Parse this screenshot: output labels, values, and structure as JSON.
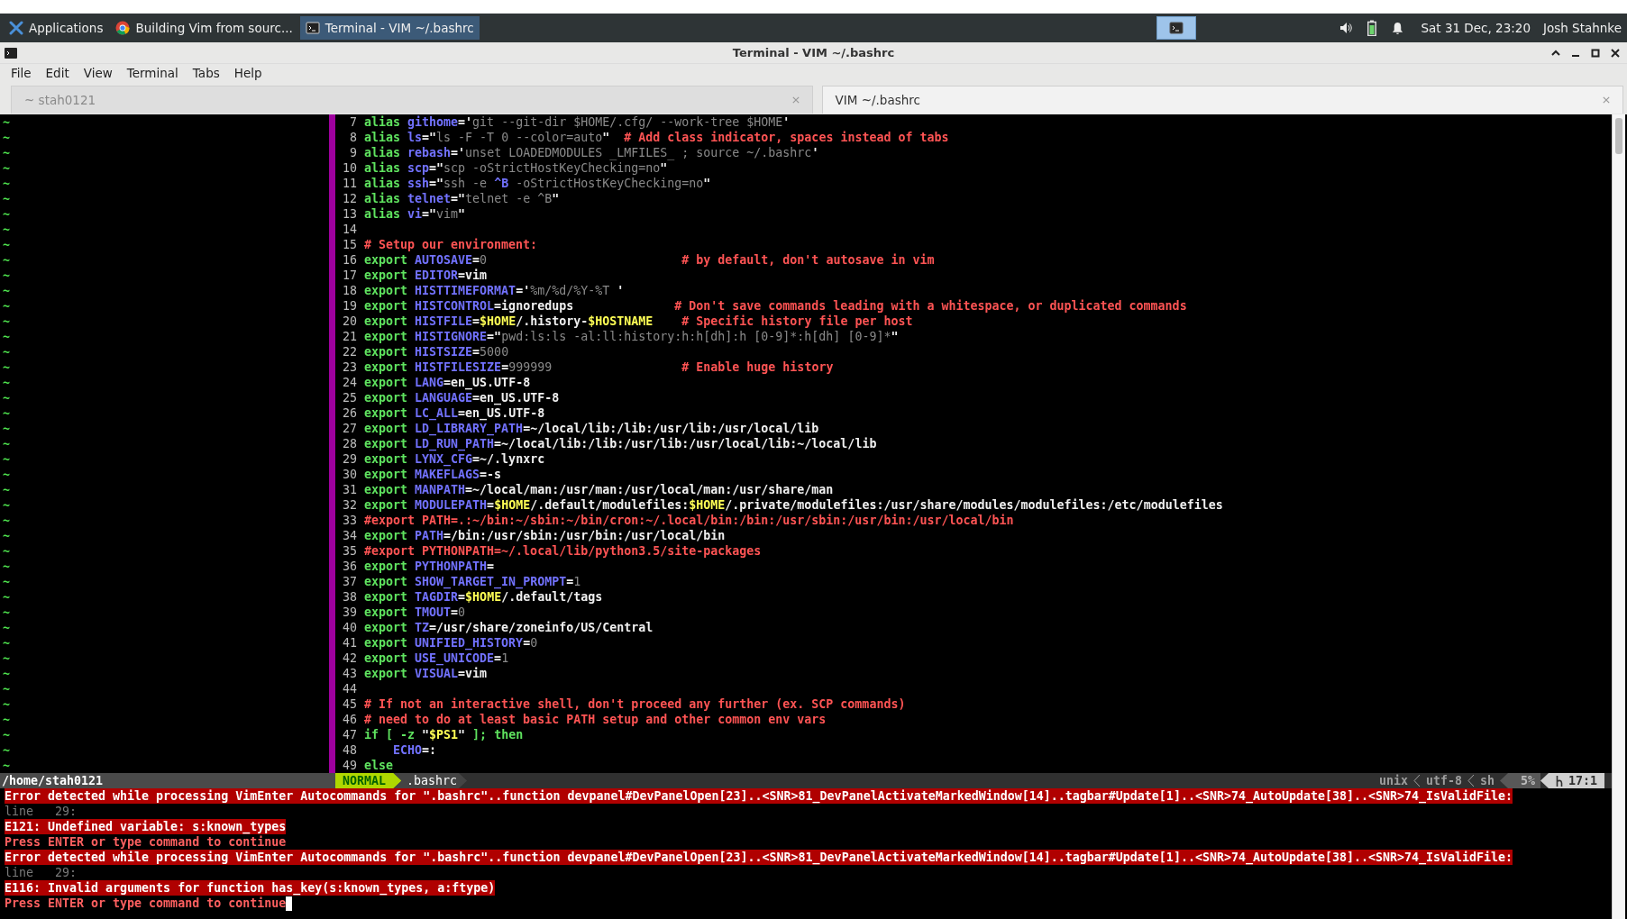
{
  "taskbar": {
    "apps_menu": "Applications",
    "tasks": [
      {
        "label": "Building Vim from sourc...",
        "selected": false,
        "kind": "browser"
      },
      {
        "label": "Terminal - VIM ~/.bashrc",
        "selected": true,
        "kind": "terminal"
      }
    ],
    "clock": "Sat 31 Dec, 23:20",
    "user": "Josh Stahnke"
  },
  "window": {
    "title": "Terminal - VIM ~/.bashrc"
  },
  "menu": [
    "File",
    "Edit",
    "View",
    "Terminal",
    "Tabs",
    "Help"
  ],
  "tabs": [
    {
      "label": "~ stah0121",
      "selected": false
    },
    {
      "label": "VIM ~/.bashrc",
      "selected": true
    }
  ],
  "left_pane": {
    "lines": [
      "~",
      "~",
      "~",
      "~",
      "~",
      "~",
      "~",
      "~",
      "~",
      "~",
      "~",
      "~",
      "~",
      "~",
      "~",
      "~",
      "~",
      "~",
      "~",
      "~",
      "~",
      "~",
      "~",
      "~",
      "~",
      "~",
      "~",
      "~",
      "~",
      "~",
      "~",
      "~",
      "~",
      "~",
      "~",
      "~",
      "~",
      "~",
      "~",
      "~",
      "~",
      "~",
      "~"
    ],
    "path": "/home/stah0121"
  },
  "editor": {
    "lines": [
      {
        "number": "7",
        "segments": [
          {
            "kind": "kw",
            "text": "alias "
          },
          {
            "kind": "id",
            "text": "githome"
          },
          {
            "kind": "op",
            "text": "='"
          },
          {
            "kind": "str",
            "text": "git --git-dir $HOME/.cfg/ --work-tree $HOME"
          },
          {
            "kind": "op",
            "text": "'"
          }
        ]
      },
      {
        "number": "8",
        "segments": [
          {
            "kind": "kw",
            "text": "alias "
          },
          {
            "kind": "id",
            "text": "ls"
          },
          {
            "kind": "op",
            "text": "=\""
          },
          {
            "kind": "str",
            "text": "ls -F -T 0 --color=auto"
          },
          {
            "kind": "op",
            "text": "\"  "
          },
          {
            "kind": "cm",
            "text": "# Add class indicator, spaces instead of tabs"
          }
        ]
      },
      {
        "number": "9",
        "segments": [
          {
            "kind": "kw",
            "text": "alias "
          },
          {
            "kind": "id",
            "text": "rebash"
          },
          {
            "kind": "op",
            "text": "='"
          },
          {
            "kind": "str",
            "text": "unset LOADEDMODULES _LMFILES_ ; source ~/.bashrc"
          },
          {
            "kind": "op",
            "text": "'"
          }
        ]
      },
      {
        "number": "10",
        "segments": [
          {
            "kind": "kw",
            "text": "alias "
          },
          {
            "kind": "id",
            "text": "scp"
          },
          {
            "kind": "op",
            "text": "=\""
          },
          {
            "kind": "str",
            "text": "scp -oStrictHostKeyChecking=no"
          },
          {
            "kind": "op",
            "text": "\""
          }
        ]
      },
      {
        "number": "11",
        "segments": [
          {
            "kind": "kw",
            "text": "alias "
          },
          {
            "kind": "id",
            "text": "ssh"
          },
          {
            "kind": "op",
            "text": "=\""
          },
          {
            "kind": "str",
            "text": "ssh -e "
          },
          {
            "kind": "id",
            "text": "^B"
          },
          {
            "kind": "str",
            "text": " -oStrictHostKeyChecking=no"
          },
          {
            "kind": "op",
            "text": "\""
          }
        ]
      },
      {
        "number": "12",
        "segments": [
          {
            "kind": "kw",
            "text": "alias "
          },
          {
            "kind": "id",
            "text": "telnet"
          },
          {
            "kind": "op",
            "text": "=\""
          },
          {
            "kind": "str",
            "text": "telnet -e ^B"
          },
          {
            "kind": "op",
            "text": "\""
          }
        ]
      },
      {
        "number": "13",
        "segments": [
          {
            "kind": "kw",
            "text": "alias "
          },
          {
            "kind": "id",
            "text": "vi"
          },
          {
            "kind": "op",
            "text": "=\""
          },
          {
            "kind": "str",
            "text": "vim"
          },
          {
            "kind": "op",
            "text": "\""
          }
        ]
      },
      {
        "number": "14"
      },
      {
        "number": "15",
        "segments": [
          {
            "kind": "cm",
            "text": "# Setup our environment:"
          }
        ]
      },
      {
        "number": "16",
        "segments": [
          {
            "kind": "kw",
            "text": "export "
          },
          {
            "kind": "id",
            "text": "AUTOSAVE"
          },
          {
            "kind": "op",
            "text": "="
          },
          {
            "kind": "str",
            "text": "0"
          },
          {
            "kind": "cm",
            "text": "                           # by default, don't autosave in vim"
          }
        ]
      },
      {
        "number": "17",
        "segments": [
          {
            "kind": "kw",
            "text": "export "
          },
          {
            "kind": "id",
            "text": "EDITOR"
          },
          {
            "kind": "op",
            "text": "=vim"
          }
        ]
      },
      {
        "number": "18",
        "segments": [
          {
            "kind": "kw",
            "text": "export "
          },
          {
            "kind": "id",
            "text": "HISTTIMEFORMAT"
          },
          {
            "kind": "op",
            "text": "='"
          },
          {
            "kind": "str",
            "text": "%m/%d/%Y-%T "
          },
          {
            "kind": "op",
            "text": "'"
          }
        ]
      },
      {
        "number": "19",
        "segments": [
          {
            "kind": "kw",
            "text": "export "
          },
          {
            "kind": "id",
            "text": "HISTCONTROL"
          },
          {
            "kind": "op",
            "text": "=ignoredups              "
          },
          {
            "kind": "cm",
            "text": "# Don't save commands leading with a whitespace, or duplicated commands"
          }
        ]
      },
      {
        "number": "20",
        "segments": [
          {
            "kind": "kw",
            "text": "export "
          },
          {
            "kind": "id",
            "text": "HISTFILE"
          },
          {
            "kind": "op",
            "text": "="
          },
          {
            "kind": "sp",
            "text": "$HOME"
          },
          {
            "kind": "op",
            "text": "/.history-"
          },
          {
            "kind": "sp",
            "text": "$HOSTNAME"
          },
          {
            "kind": "cm",
            "text": "    # Specific history file per host"
          }
        ]
      },
      {
        "number": "21",
        "segments": [
          {
            "kind": "kw",
            "text": "export "
          },
          {
            "kind": "id",
            "text": "HISTIGNORE"
          },
          {
            "kind": "op",
            "text": "=\""
          },
          {
            "kind": "str",
            "text": "pwd:ls:ls -al:ll:history:h:h[dh]:h [0-9]*:h[dh] [0-9]*"
          },
          {
            "kind": "op",
            "text": "\""
          }
        ]
      },
      {
        "number": "22",
        "segments": [
          {
            "kind": "kw",
            "text": "export "
          },
          {
            "kind": "id",
            "text": "HISTSIZE"
          },
          {
            "kind": "op",
            "text": "="
          },
          {
            "kind": "str",
            "text": "5000"
          }
        ]
      },
      {
        "number": "23",
        "segments": [
          {
            "kind": "kw",
            "text": "export "
          },
          {
            "kind": "id",
            "text": "HISTFILESIZE"
          },
          {
            "kind": "op",
            "text": "="
          },
          {
            "kind": "str",
            "text": "999999"
          },
          {
            "kind": "cm",
            "text": "                  # Enable huge history"
          }
        ]
      },
      {
        "number": "24",
        "segments": [
          {
            "kind": "kw",
            "text": "export "
          },
          {
            "kind": "id",
            "text": "LANG"
          },
          {
            "kind": "op",
            "text": "=en_US.UTF-8"
          }
        ]
      },
      {
        "number": "25",
        "segments": [
          {
            "kind": "kw",
            "text": "export "
          },
          {
            "kind": "id",
            "text": "LANGUAGE"
          },
          {
            "kind": "op",
            "text": "=en_US.UTF-8"
          }
        ]
      },
      {
        "number": "26",
        "segments": [
          {
            "kind": "kw",
            "text": "export "
          },
          {
            "kind": "id",
            "text": "LC_ALL"
          },
          {
            "kind": "op",
            "text": "=en_US.UTF-8"
          }
        ]
      },
      {
        "number": "27",
        "segments": [
          {
            "kind": "kw",
            "text": "export "
          },
          {
            "kind": "id",
            "text": "LD_LIBRARY_PATH"
          },
          {
            "kind": "op",
            "text": "=~/local/lib:/lib:/usr/lib:/usr/local/lib"
          }
        ]
      },
      {
        "number": "28",
        "segments": [
          {
            "kind": "kw",
            "text": "export "
          },
          {
            "kind": "id",
            "text": "LD_RUN_PATH"
          },
          {
            "kind": "op",
            "text": "=~/local/lib:/lib:/usr/lib:/usr/local/lib:~/local/lib"
          }
        ]
      },
      {
        "number": "29",
        "segments": [
          {
            "kind": "kw",
            "text": "export "
          },
          {
            "kind": "id",
            "text": "LYNX_CFG"
          },
          {
            "kind": "op",
            "text": "=~/.lynxrc"
          }
        ]
      },
      {
        "number": "30",
        "segments": [
          {
            "kind": "kw",
            "text": "export "
          },
          {
            "kind": "id",
            "text": "MAKEFLAGS"
          },
          {
            "kind": "op",
            "text": "=-s"
          }
        ]
      },
      {
        "number": "31",
        "segments": [
          {
            "kind": "kw",
            "text": "export "
          },
          {
            "kind": "id",
            "text": "MANPATH"
          },
          {
            "kind": "op",
            "text": "=~/local/man:/usr/man:/usr/local/man:/usr/share/man"
          }
        ]
      },
      {
        "number": "32",
        "segments": [
          {
            "kind": "kw",
            "text": "export "
          },
          {
            "kind": "id",
            "text": "MODULEPATH"
          },
          {
            "kind": "op",
            "text": "="
          },
          {
            "kind": "sp",
            "text": "$HOME"
          },
          {
            "kind": "op",
            "text": "/.default/modulefiles:"
          },
          {
            "kind": "sp",
            "text": "$HOME"
          },
          {
            "kind": "op",
            "text": "/.private/modulefiles:/usr/share/modules/modulefiles:/etc/modulefiles"
          }
        ]
      },
      {
        "number": "33",
        "segments": [
          {
            "kind": "cm",
            "text": "#export PATH=.:~/bin:~/sbin:~/bin/cron:~/.local/bin:/bin:/usr/sbin:/usr/bin:/usr/local/bin"
          }
        ]
      },
      {
        "number": "34",
        "segments": [
          {
            "kind": "kw",
            "text": "export "
          },
          {
            "kind": "id",
            "text": "PATH"
          },
          {
            "kind": "op",
            "text": "=/bin:/usr/sbin:/usr/bin:/usr/local/bin"
          }
        ]
      },
      {
        "number": "35",
        "segments": [
          {
            "kind": "cm",
            "text": "#export PYTHONPATH=~/.local/lib/python3.5/site-packages"
          }
        ]
      },
      {
        "number": "36",
        "segments": [
          {
            "kind": "kw",
            "text": "export "
          },
          {
            "kind": "id",
            "text": "PYTHONPATH"
          },
          {
            "kind": "op",
            "text": "="
          }
        ]
      },
      {
        "number": "37",
        "segments": [
          {
            "kind": "kw",
            "text": "export "
          },
          {
            "kind": "id",
            "text": "SHOW_TARGET_IN_PROMPT"
          },
          {
            "kind": "op",
            "text": "="
          },
          {
            "kind": "str",
            "text": "1"
          }
        ]
      },
      {
        "number": "38",
        "segments": [
          {
            "kind": "kw",
            "text": "export "
          },
          {
            "kind": "id",
            "text": "TAGDIR"
          },
          {
            "kind": "op",
            "text": "="
          },
          {
            "kind": "sp",
            "text": "$HOME"
          },
          {
            "kind": "op",
            "text": "/.default/tags"
          }
        ]
      },
      {
        "number": "39",
        "segments": [
          {
            "kind": "kw",
            "text": "export "
          },
          {
            "kind": "id",
            "text": "TMOUT"
          },
          {
            "kind": "op",
            "text": "="
          },
          {
            "kind": "str",
            "text": "0"
          }
        ]
      },
      {
        "number": "40",
        "segments": [
          {
            "kind": "kw",
            "text": "export "
          },
          {
            "kind": "id",
            "text": "TZ"
          },
          {
            "kind": "op",
            "text": "=/usr/share/zoneinfo/US/Central"
          }
        ]
      },
      {
        "number": "41",
        "segments": [
          {
            "kind": "kw",
            "text": "export "
          },
          {
            "kind": "id",
            "text": "UNIFIED_HISTORY"
          },
          {
            "kind": "op",
            "text": "="
          },
          {
            "kind": "str",
            "text": "0"
          }
        ]
      },
      {
        "number": "42",
        "segments": [
          {
            "kind": "kw",
            "text": "export "
          },
          {
            "kind": "id",
            "text": "USE_UNICODE"
          },
          {
            "kind": "op",
            "text": "="
          },
          {
            "kind": "str",
            "text": "1"
          }
        ]
      },
      {
        "number": "43",
        "segments": [
          {
            "kind": "kw",
            "text": "export "
          },
          {
            "kind": "id",
            "text": "VISUAL"
          },
          {
            "kind": "op",
            "text": "=vim"
          }
        ]
      },
      {
        "number": "44"
      },
      {
        "number": "45",
        "segments": [
          {
            "kind": "cm",
            "text": "# If not an interactive shell, don't proceed any further (ex. SCP commands)"
          }
        ]
      },
      {
        "number": "46",
        "segments": [
          {
            "kind": "cm",
            "text": "# need to do at least basic PATH setup and other common env vars"
          }
        ]
      },
      {
        "number": "47",
        "segments": [
          {
            "kind": "kw",
            "text": "if [ -z "
          },
          {
            "kind": "op",
            "text": "\""
          },
          {
            "kind": "sp",
            "text": "$PS1"
          },
          {
            "kind": "op",
            "text": "\""
          },
          {
            "kind": "kw",
            "text": " ]; then"
          }
        ]
      },
      {
        "number": "48",
        "segments": [
          {
            "kind": "id",
            "text": "    ECHO"
          },
          {
            "kind": "op",
            "text": "=:"
          }
        ]
      },
      {
        "number": "49",
        "segments": [
          {
            "kind": "kw",
            "text": "else"
          }
        ]
      }
    ]
  },
  "statusline": {
    "mode": "NORMAL",
    "file": ".bashrc",
    "format": "unix",
    "encoding": "utf-8",
    "filetype": "sh",
    "percent": "5%",
    "position": "17:1"
  },
  "messages": [
    {
      "kind": "error",
      "text": "Error detected while processing VimEnter Autocommands for \".bashrc\"..function devpanel#DevPanelOpen[23]..<SNR>81_DevPanelActivateMarkedWindow[14]..tagbar#Update[1]..<SNR>74_AutoUpdate[38]..<SNR>74_IsValidFile:"
    },
    {
      "kind": "info",
      "text": "line   29:"
    },
    {
      "kind": "error",
      "text": "E121: Undefined variable: s:known_types"
    },
    {
      "kind": "prompt",
      "text": "Press ENTER or type command to continue"
    },
    {
      "kind": "error",
      "text": "Error detected while processing VimEnter Autocommands for \".bashrc\"..function devpanel#DevPanelOpen[23]..<SNR>81_DevPanelActivateMarkedWindow[14]..tagbar#Update[1]..<SNR>74_AutoUpdate[38]..<SNR>74_IsValidFile:"
    },
    {
      "kind": "info",
      "text": "line   29:"
    },
    {
      "kind": "error",
      "text": "E116: Invalid arguments for function has_key(s:known_types, a:ftype)"
    },
    {
      "kind": "prompt",
      "text": "Press ENTER or type command to continue"
    }
  ]
}
